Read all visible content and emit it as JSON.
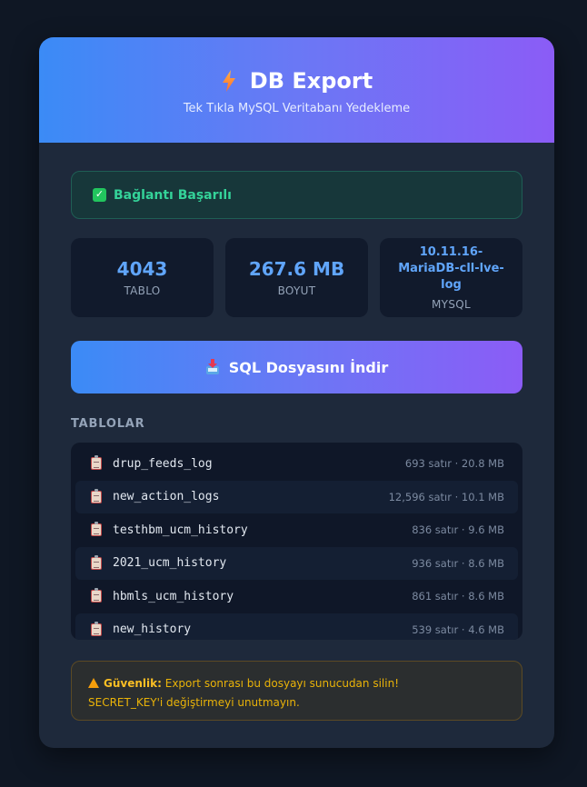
{
  "header": {
    "title": "DB Export",
    "subtitle": "Tek Tıkla MySQL Veritabanı Yedekleme",
    "icon": "lightning-bolt-icon"
  },
  "status": {
    "text": "Bağlantı Başarılı",
    "icon": "check-icon",
    "color": "#34d399"
  },
  "stats": [
    {
      "value": "4043",
      "label": "TABLO"
    },
    {
      "value": "267.6 MB",
      "label": "BOYUT"
    },
    {
      "value": "10.11.16-MariaDB-cll-lve-log",
      "label": "MYSQL"
    }
  ],
  "download": {
    "label": "SQL Dosyasını İndir",
    "icon": "inbox-tray-icon"
  },
  "tables_section": {
    "title": "TABLOLAR",
    "rows": [
      {
        "name": "drup_feeds_log",
        "meta": "693 satır · 20.8 MB"
      },
      {
        "name": "new_action_logs",
        "meta": "12,596 satır · 10.1 MB"
      },
      {
        "name": "testhbm_ucm_history",
        "meta": "836 satır · 9.6 MB"
      },
      {
        "name": "2021_ucm_history",
        "meta": "936 satır · 8.6 MB"
      },
      {
        "name": "hbmls_ucm_history",
        "meta": "861 satır · 8.6 MB"
      },
      {
        "name": "new_history",
        "meta": "539 satır · 4.6 MB"
      }
    ]
  },
  "warning": {
    "strong": "Güvenlik:",
    "line1": "Export sonrası bu dosyayı sunucudan silin!",
    "line2": "SECRET_KEY'i değiştirmeyi unutmayın."
  },
  "colors": {
    "accent_start": "#3b8bf6",
    "accent_end": "#8b5cf6",
    "value_blue": "#60a5fa",
    "warning": "#eab308"
  }
}
